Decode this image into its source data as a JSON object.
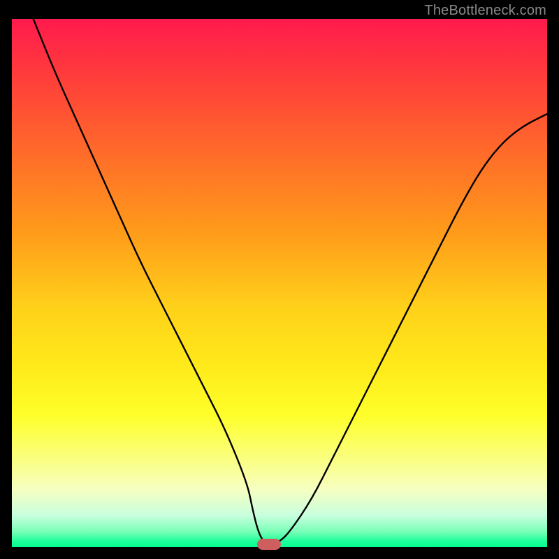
{
  "watermark": "TheBottleneck.com",
  "colors": {
    "background": "#000000",
    "curve": "#000000",
    "marker": "#cf5f5f",
    "gradient_top": "#ff1a4d",
    "gradient_bottom": "#05ff90"
  },
  "chart_data": {
    "type": "line",
    "title": "",
    "xlabel": "",
    "ylabel": "",
    "xlim": [
      0,
      100
    ],
    "ylim": [
      0,
      100
    ],
    "grid": false,
    "legend": false,
    "annotations": [],
    "series": [
      {
        "name": "bottleneck-curve",
        "x": [
          0,
          4,
          8,
          12,
          16,
          20,
          24,
          28,
          32,
          36,
          40,
          44,
          45,
          46,
          47,
          48,
          49,
          50,
          52,
          56,
          60,
          64,
          68,
          72,
          76,
          80,
          84,
          88,
          92,
          96,
          100
        ],
        "values": [
          110,
          100,
          90,
          81,
          72,
          63,
          54,
          46,
          38,
          30,
          22,
          12,
          7,
          3,
          1,
          1,
          1,
          1,
          3,
          9,
          17,
          25,
          33,
          41,
          49,
          57,
          65,
          72,
          77,
          80,
          82
        ]
      }
    ],
    "marker": {
      "x": 48,
      "y": 0.5
    }
  }
}
